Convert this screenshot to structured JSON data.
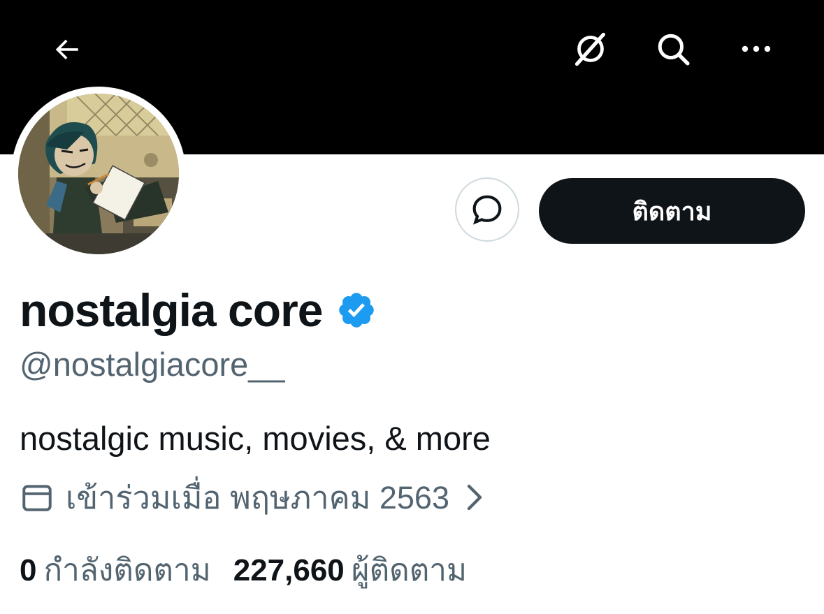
{
  "profile": {
    "display_name": "nostalgia core",
    "handle": "@nostalgiacore__",
    "bio": "nostalgic music, movies, & more",
    "joined": "เข้าร่วมเมื่อ พฤษภาคม 2563",
    "verified": true
  },
  "actions": {
    "follow_label": "ติดตาม"
  },
  "stats": {
    "following_count": "0",
    "following_label": "กำลังติดตาม",
    "followers_count": "227,660",
    "followers_label": "ผู้ติดตาม"
  },
  "icons": {
    "back": "arrow-left-icon",
    "grok": "grok-icon",
    "search": "search-icon",
    "more": "more-icon",
    "message": "message-bubble-icon",
    "verified": "verified-badge-icon",
    "calendar": "calendar-icon",
    "chevron": "chevron-right-icon"
  },
  "colors": {
    "banner": "#000000",
    "text_primary": "#0f1419",
    "text_secondary": "#536471",
    "verified": "#1d9bf0",
    "follow_button_bg": "#0f1419"
  }
}
